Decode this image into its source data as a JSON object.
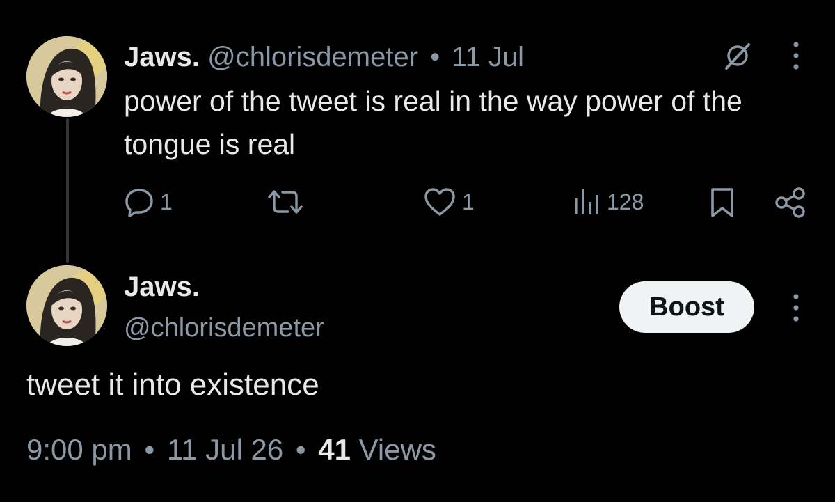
{
  "tweet": {
    "display_name": "Jaws.",
    "handle": "@chlorisdemeter",
    "separator": "•",
    "date": "11 Jul",
    "text": "power of the tweet is real in the way power of the tongue is real",
    "actions": {
      "reply_count": "1",
      "like_count": "1",
      "views_count": "128"
    }
  },
  "reply": {
    "display_name": "Jaws.",
    "handle": "@chlorisdemeter",
    "boost_label": "Boost",
    "text": "tweet it into existence",
    "time": "9:00 pm",
    "separator": "•",
    "date": "11 Jul 26",
    "views_count": "41",
    "views_label": "Views"
  },
  "colors": {
    "background": "#000000",
    "text_primary": "#e7e9ea",
    "text_secondary": "#8b98a5",
    "boost_bg": "#eff3f4"
  },
  "icons": [
    "grok-icon",
    "more-icon",
    "reply-icon",
    "retweet-icon",
    "like-icon",
    "views-icon",
    "bookmark-icon",
    "share-icon"
  ]
}
